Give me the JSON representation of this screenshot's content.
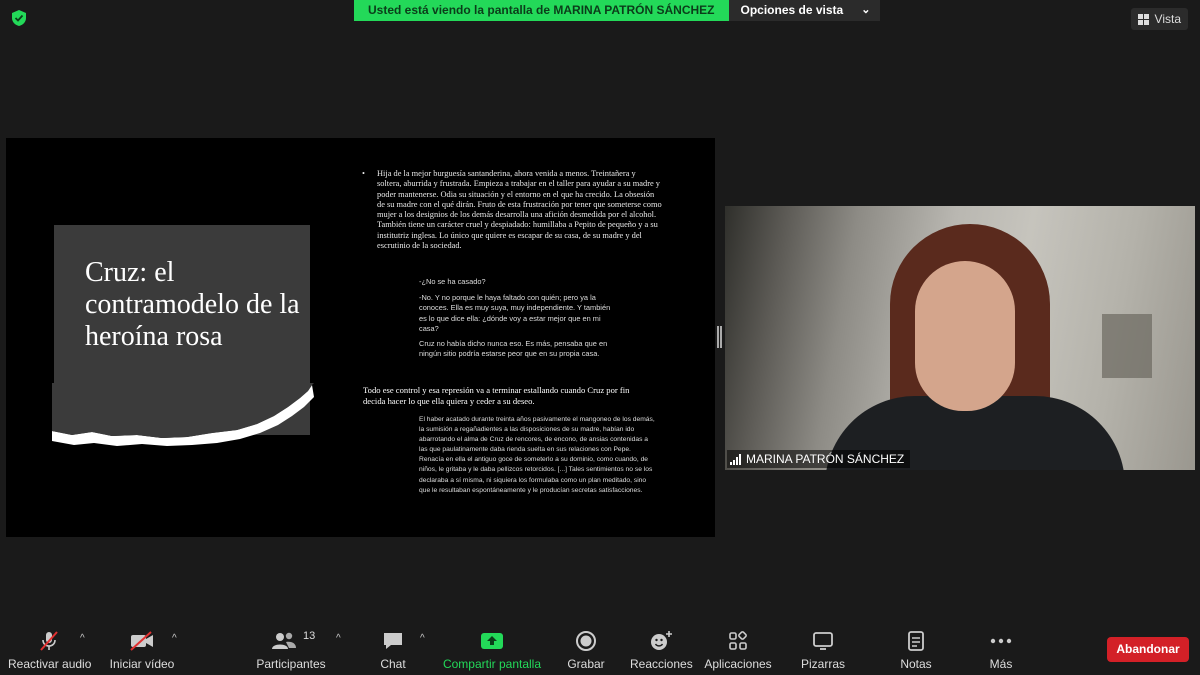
{
  "top_bar": {
    "security_icon": "shield-check-icon",
    "sharing_banner": "Usted está viendo la pantalla de MARINA PATRÓN SÁNCHEZ",
    "view_options_label": "Opciones de vista",
    "view_button_label": "Vista",
    "colors": {
      "banner": "#23d959",
      "background": "#1a1a1a"
    }
  },
  "slide": {
    "title": "Cruz: el contramodelo de la heroína rosa",
    "bullet_text": "Hija de la mejor burguesía santanderina, ahora venida a menos. Treintañera y soltera, aburrida y frustrada. Empieza a trabajar en el taller para ayudar a su madre y poder mantenerse. Odia su situación y el entorno en el que ha crecido. La obsesión de su madre con el qué dirán. Fruto de esta frustración por tener que someterse como mujer a los designios de los demás desarrolla una afición desmedida por el alcohol. También tiene un carácter cruel y despiadado: humillaba a Pepito de pequeño y a su institutriz inglesa. Lo único que quiere es escapar de su casa, de su madre y del escrutinio de la sociedad.",
    "quote_1": "-¿No se ha casado?",
    "quote_2": "-No. Y no porque le haya faltado con quién; pero ya la conoces. Ella es muy suya, muy independiente. Y también es lo que dice ella: ¿dónde voy a estar mejor que en mi casa?",
    "quote_3": "Cruz no había dicho nunca eso. Es más, pensaba que en ningún sitio podría estarse peor que en su propia casa.",
    "mid_paragraph": "Todo ese control y esa represión va a terminar estallando cuando Cruz por fin decida hacer lo que ella quiera y ceder a su deseo.",
    "long_quote": "El haber acatado durante treinta años pasivamente el mangoneo de los demás, la sumisión a regañadientes a las disposiciones de su madre, habían ido abarrotando el alma de Cruz de rencores, de encono, de ansias contenidas a las que paulatinamente daba rienda suelta en sus relaciones con Pepe. Renacía en ella el antiguo goce de someterlo a su dominio, como cuando, de niños, le gritaba y le daba pellizcos retorcidos. [...] Tales sentimientos no se los declaraba a sí misma, ni siquiera los formulaba como un plan meditado, sino que le resultaban espontáneamente y le producían secretas satisfacciones."
  },
  "video_tile": {
    "participant_name": "MARINA PATRÓN SÁNCHEZ"
  },
  "toolbar": {
    "items": [
      {
        "label": "Reactivar audio",
        "icon": "microphone-muted-icon"
      },
      {
        "label": "Iniciar vídeo",
        "icon": "video-off-icon"
      },
      {
        "label": "Participantes",
        "icon": "participants-icon",
        "count": "13"
      },
      {
        "label": "Chat",
        "icon": "chat-icon"
      },
      {
        "label": "Compartir pantalla",
        "icon": "share-screen-icon"
      },
      {
        "label": "Grabar",
        "icon": "record-icon"
      },
      {
        "label": "Reacciones",
        "icon": "reactions-icon"
      },
      {
        "label": "Aplicaciones",
        "icon": "apps-icon"
      },
      {
        "label": "Pizarras",
        "icon": "whiteboard-icon"
      },
      {
        "label": "Notas",
        "icon": "notes-icon"
      },
      {
        "label": "Más",
        "icon": "more-icon"
      }
    ],
    "leave_label": "Abandonar",
    "colors": {
      "share": "#23d959",
      "leave": "#d32027"
    }
  }
}
